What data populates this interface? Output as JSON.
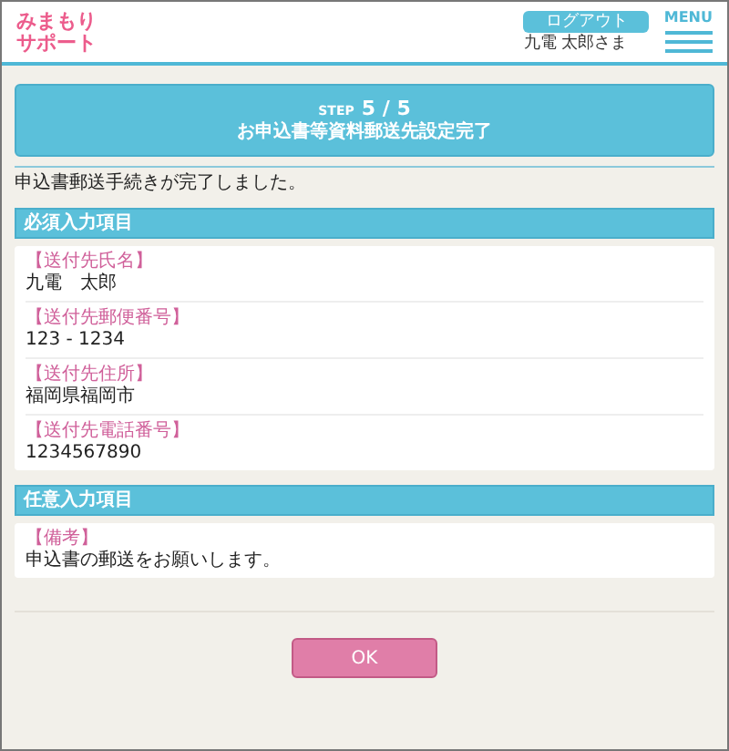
{
  "header": {
    "logo_lines": [
      "みまもり",
      "サポート"
    ],
    "logout_button": "ログアウト",
    "user_name": "九電 太郎さま",
    "menu_label": "MENU"
  },
  "banner": {
    "step_label": "STEP",
    "step": "5 / 5",
    "title": "お申込書等資料郵送先設定完了"
  },
  "message": "申込書郵送手続きが完了しました。",
  "sections": [
    {
      "title": "必須入力項目",
      "fields": [
        {
          "label": "【送付先氏名】",
          "value": "九電　太郎"
        },
        {
          "label": "【送付先郵便番号】",
          "value": "123 - 1234"
        },
        {
          "label": "【送付先住所】",
          "value": "福岡県福岡市"
        },
        {
          "label": "【送付先電話番号】",
          "value": "1234567890"
        }
      ]
    },
    {
      "title": "任意入力項目",
      "fields": [
        {
          "label": "【備考】",
          "value": "申込書の郵送をお願いします。"
        }
      ]
    }
  ],
  "ok_button": "OK"
}
